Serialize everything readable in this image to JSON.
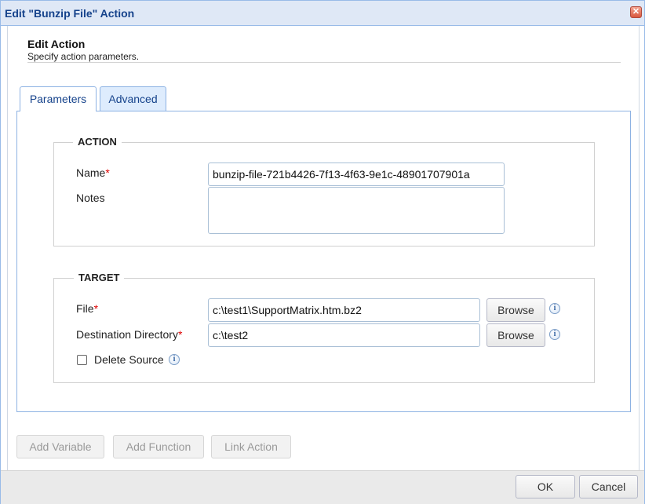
{
  "window": {
    "title": "Edit \"Bunzip File\" Action",
    "close_glyph": "✕"
  },
  "header": {
    "title": "Edit Action",
    "subtitle": "Specify action parameters."
  },
  "tabs": [
    {
      "label": "Parameters",
      "active": true
    },
    {
      "label": "Advanced",
      "active": false
    }
  ],
  "action_group": {
    "legend": "ACTION",
    "name_label": "Name",
    "name_value": "bunzip-file-721b4426-7f13-4f63-9e1c-48901707901a",
    "notes_label": "Notes",
    "notes_value": ""
  },
  "target_group": {
    "legend": "TARGET",
    "file_label": "File",
    "file_value": "c:\\test1\\SupportMatrix.htm.bz2",
    "dest_label": "Destination Directory",
    "dest_value": "c:\\test2",
    "browse_label": "Browse",
    "delete_source_label": "Delete Source",
    "delete_source_checked": false
  },
  "required_mark": "*",
  "info_glyph": "i",
  "bottom_buttons": {
    "add_variable": "Add Variable",
    "add_function": "Add Function",
    "link_action": "Link Action"
  },
  "footer": {
    "ok": "OK",
    "cancel": "Cancel"
  }
}
